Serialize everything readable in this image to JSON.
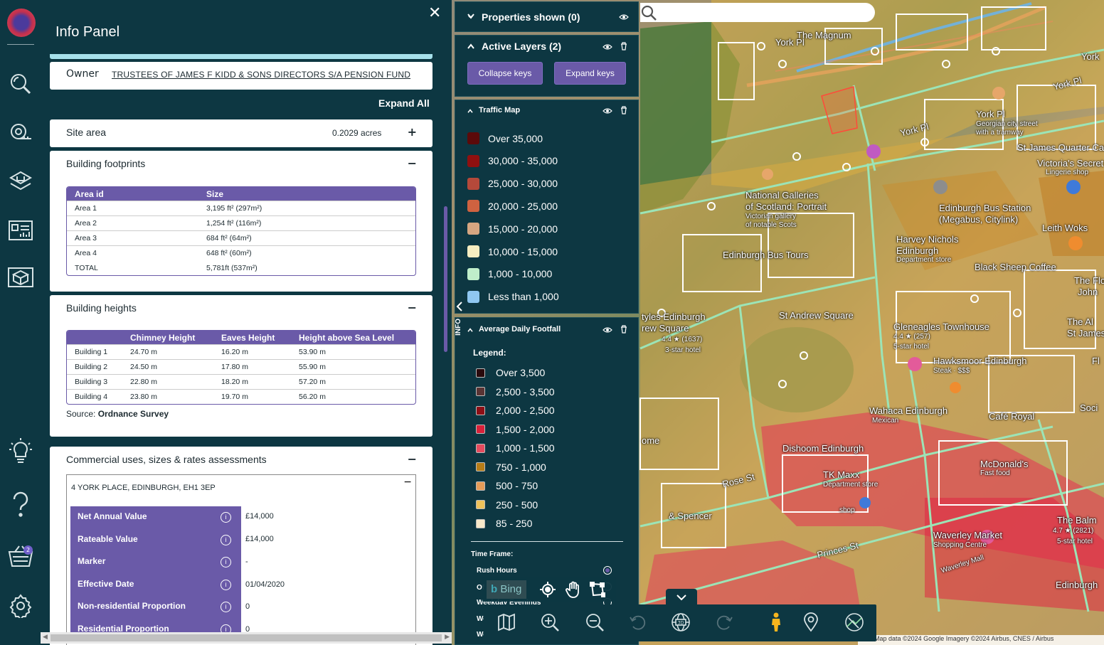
{
  "info_panel": {
    "title": "Info Panel",
    "close": "✕",
    "owner_label": "Owner",
    "owner_value": "TRUSTEES OF JAMES F KIDD & SONS DIRECTORS S/A PENSION FUND",
    "expand_all": "Expand All",
    "site_area": {
      "label": "Site area",
      "value": "0.2029 acres",
      "toggle": "+"
    },
    "footprints": {
      "label": "Building footprints",
      "toggle": "−",
      "headers": [
        "Area id",
        "Size"
      ],
      "rows": [
        [
          "Area 1",
          "3,195 ft² (297m²)"
        ],
        [
          "Area 2",
          "1,254 ft² (116m²)"
        ],
        [
          "Area 3",
          "684 ft² (64m²)"
        ],
        [
          "Area 4",
          "648 ft² (60m²)"
        ],
        [
          "TOTAL",
          "5,781ft  (537m²)"
        ]
      ]
    },
    "heights": {
      "label": "Building heights",
      "toggle": "−",
      "headers": [
        "",
        "Chimney Height",
        "Eaves Height",
        "Height above Sea Level"
      ],
      "rows": [
        [
          "Building 1",
          "24.70 m",
          "16.20 m",
          "53.90 m"
        ],
        [
          "Building 2",
          "24.50 m",
          "17.80 m",
          "55.90 m"
        ],
        [
          "Building 3",
          "22.80 m",
          "18.20 m",
          "57.20 m"
        ],
        [
          "Building 4",
          "23.80 m",
          "19.70 m",
          "56.20 m"
        ]
      ],
      "source_label": "Source:",
      "source_value": "Ordnance Survey"
    },
    "commercial": {
      "label": "Commercial uses, sizes & rates assessments",
      "toggle": "−",
      "address": "4 YORK PLACE, EDINBURGH, EH1 3EP",
      "address_toggle": "−",
      "rows": [
        {
          "label": "Net Annual Value",
          "value": "£14,000"
        },
        {
          "label": "Rateable Value",
          "value": "£14,000"
        },
        {
          "label": "Marker",
          "value": "-"
        },
        {
          "label": "Effective Date",
          "value": "01/04/2020"
        },
        {
          "label": "Non-residential Proportion",
          "value": "0"
        },
        {
          "label": "Residential Proportion",
          "value": "0"
        }
      ]
    }
  },
  "sidebar": {
    "basket_count": "2"
  },
  "layers": {
    "properties_shown": "Properties shown (0)",
    "active_layers": "Active Layers (2)",
    "collapse_keys": "Collapse keys",
    "expand_keys": "Expand keys",
    "info_tab": "INFO",
    "traffic": {
      "title": "Traffic Map",
      "keys": [
        {
          "label": "Over 35,000",
          "color": "#5b0a0a"
        },
        {
          "label": "30,000 - 35,000",
          "color": "#8f1010"
        },
        {
          "label": "25,000 - 30,000",
          "color": "#b5493a"
        },
        {
          "label": "20,000 - 25,000",
          "color": "#cf6240"
        },
        {
          "label": "15,000 - 20,000",
          "color": "#d6a681"
        },
        {
          "label": "10,000 - 15,000",
          "color": "#f6edc1"
        },
        {
          "label": "1,000 - 10,000",
          "color": "#bfeeca"
        },
        {
          "label": "Less than 1,000",
          "color": "#8fc7f1"
        }
      ]
    },
    "footfall": {
      "title": "Average Daily Footfall",
      "legend_label": "Legend:",
      "keys": [
        {
          "label": "Over 3,500",
          "color": "#2a0a0d"
        },
        {
          "label": "2,500 - 3,500",
          "color": "#5a3434"
        },
        {
          "label": "2,000 - 2,500",
          "color": "#8e0f16"
        },
        {
          "label": "1,500 - 2,000",
          "color": "#d8213a"
        },
        {
          "label": "1,000 - 1,500",
          "color": "#e64b5e"
        },
        {
          "label": "750 - 1,000",
          "color": "#b67d17"
        },
        {
          "label": "500 - 750",
          "color": "#e59c58"
        },
        {
          "label": "250 - 500",
          "color": "#efc25a"
        },
        {
          "label": "85 - 250",
          "color": "#f7e8c9"
        }
      ],
      "timeframe_label": "Time Frame:",
      "options": [
        "Rush Hours",
        "Of",
        "Weekday Evenings",
        "We",
        "We"
      ]
    }
  },
  "toolbar": {
    "bing": "Bing"
  },
  "map": {
    "attribution": "cuts   Map data ©2024 Google Imagery ©2024 Airbus, CNES / Airbus",
    "labels": {
      "magnum": "The Magnum",
      "york_pl_1": "York Pl",
      "york_pl_2": "York Pl",
      "york_pl_3": "York Pl",
      "york": "York",
      "york_pl_city": "York Pl",
      "georgian": "Georgian city street",
      "with_tramway": "with a tramway",
      "st_james_quarter": "St James Quarter Car",
      "victorias_secret": "Victoria's Secret",
      "lingerie": "Lingerie shop",
      "national_gallery": "National Galleries",
      "of_scotland": "of Scotland: Portrait",
      "victorian_gallery": "Victorian gallery",
      "notable_scots": "of notable Scots",
      "bus_station": "Edinburgh Bus Station",
      "megabus": "(Megabus, Citylink)",
      "harvey_nichols": "Harvey Nichols",
      "hn_edinburgh": "Edinburgh",
      "department_store": "Department store",
      "leith_woks": "Leith Woks",
      "bus_tours": "Edinburgh Bus Tours",
      "black_sheep": "Black Sheep Coffee",
      "the_flo": "The Flo",
      "john": "John",
      "st_andrew": "St Andrew Square",
      "styles": "tyles Edinburgh",
      "rew_square": "rew Square",
      "rating_1637": "4.4 ★ (1637)",
      "three_star": "3-star hotel",
      "gleneagles": "Gleneagles Townhouse",
      "rating_257": "4.4 ★ (257)",
      "five_star_1": "5-star hotel",
      "hawksmoor": "Hawksmoor Edinburgh",
      "steak": "Steak · $$$",
      "the_al": "The Al",
      "st_james": "St James",
      "fl": "Fl",
      "soci": "Soci",
      "wahaca": "Wahaca Edinburgh",
      "mexican": "Mexican",
      "cafe_royal": "Café Royal",
      "dishoom": "Dishoom Edinburgh",
      "tk_maxx": "TK Maxx",
      "tk_dept": "Department store",
      "mcdonalds": "McDonald's",
      "fast_food": "Fast food",
      "rose_st": "Rose St",
      "shop": "shop",
      "ome": "ome",
      "spencer": "& Spencer",
      "princes_st": "Princes St",
      "waverley_market": "Waverley Market",
      "shopping_centre": "Shopping Centre",
      "waverley_mall": "Waverley Mall",
      "balmoral": "The Balm",
      "rating_2821": "4.7 ★ (2821)",
      "five_star_2": "5-star hotel",
      "edinburgh": "Edinburgh"
    }
  }
}
